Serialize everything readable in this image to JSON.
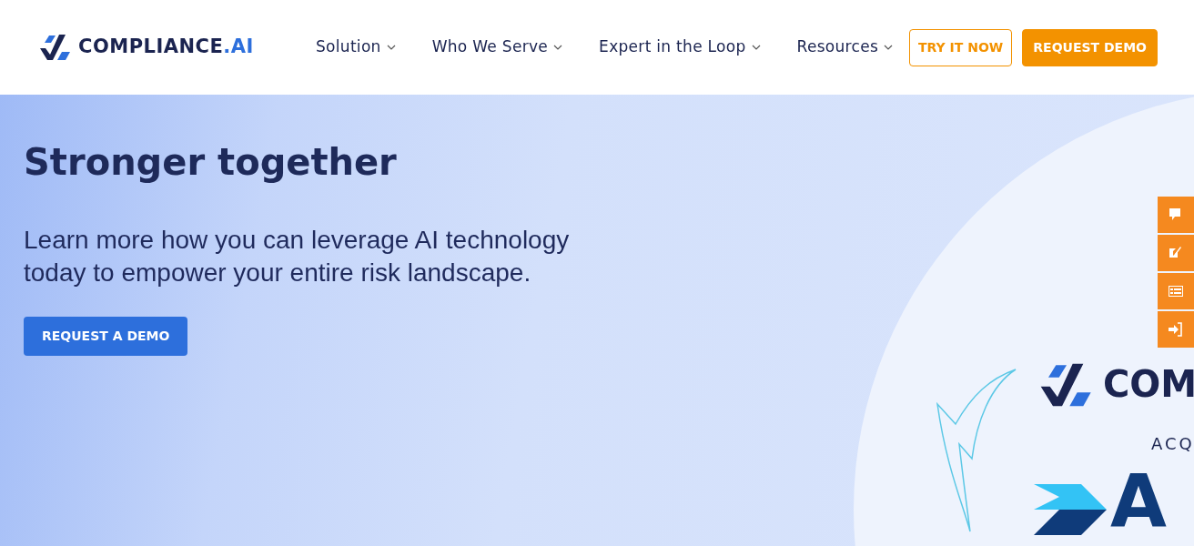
{
  "header": {
    "logo": {
      "name": "COMPLIANCE",
      "suffix": ".AI"
    },
    "nav": [
      {
        "label": "Solution",
        "has_menu": true
      },
      {
        "label": "Who We Serve",
        "has_menu": true
      },
      {
        "label": "Expert in the Loop",
        "has_menu": true
      },
      {
        "label": "Resources",
        "has_menu": true
      }
    ],
    "actions": [
      {
        "label": "TRY IT NOW",
        "kind": "outline"
      },
      {
        "label": "REQUEST DEMO",
        "kind": "solid"
      }
    ]
  },
  "hero": {
    "title": "Stronger together",
    "text": "Learn more how you can leverage AI technology today to empower your entire risk landscape.",
    "button": "REQUEST A DEMO"
  },
  "graphic": {
    "brand": "COM",
    "caption": "ACQ",
    "partner": "A"
  },
  "side_tabs": [
    {
      "kind": "comment"
    },
    {
      "kind": "edit"
    },
    {
      "kind": "form"
    },
    {
      "kind": "login"
    }
  ]
}
